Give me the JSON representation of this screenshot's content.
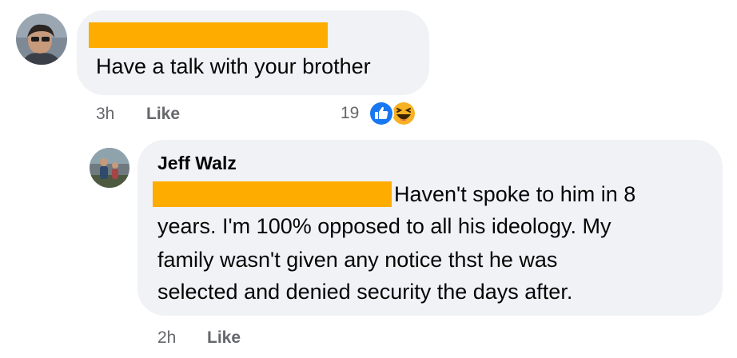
{
  "comment_1": {
    "text": "Have a talk with your brother",
    "time": "3h",
    "like_label": "Like",
    "reaction_count": "19",
    "reactions": [
      "like-icon",
      "haha-icon"
    ]
  },
  "reply_1": {
    "author": "Jeff Walz",
    "lines": [
      "Haven't spoke to him in 8",
      "years. I'm 100% opposed to all his ideology. My",
      "family wasn't given any notice thst he was",
      "selected and denied security the days after."
    ],
    "time": "2h",
    "like_label": "Like"
  },
  "colors": {
    "bubble_bg": "#f0f2f5",
    "redaction": "#ffac00",
    "meta_text": "#65676b",
    "like_blue": "#1877f2",
    "haha_yellow": "#f7b125"
  }
}
